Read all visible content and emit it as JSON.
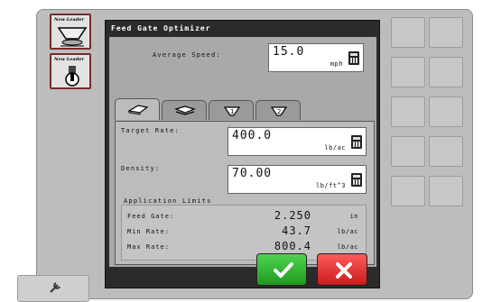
{
  "left_panel": {
    "brand_1": "New Leader",
    "brand_2": "New Leader"
  },
  "dialog": {
    "title": "Feed Gate Optimizer",
    "average_speed": {
      "label": "Average Speed:",
      "value": "15.0",
      "unit": "mph"
    },
    "tabs": [
      {
        "name": "spinner-tab",
        "icon": "spinner-icon"
      },
      {
        "name": "belt-tab",
        "icon": "belt-icon"
      },
      {
        "name": "bin-1-tab",
        "icon": "bin-1-icon"
      },
      {
        "name": "bin-2-tab",
        "icon": "bin-2-icon"
      }
    ],
    "target_rate": {
      "label": "Target Rate:",
      "value": "400.0",
      "unit": "lb/ac"
    },
    "density": {
      "label": "Density:",
      "value": "70.00",
      "unit": "lb/ft^3"
    },
    "limits": {
      "title": "Application Limits",
      "feed_gate": {
        "label": "Feed Gate:",
        "value": "2.250",
        "unit": "in"
      },
      "min_rate": {
        "label": "Min Rate:",
        "value": "43.7",
        "unit": "lb/ac"
      },
      "max_rate": {
        "label": "Max Rate:",
        "value": "800.4",
        "unit": "lb/ac"
      }
    },
    "ok_button": "accept-check-icon",
    "cancel_button": "cancel-x-icon"
  },
  "colors": {
    "ok": "#2fb52f",
    "cancel": "#e03030",
    "dialog_bg": "#2b2b2b",
    "accent_border": "#7a2a2a"
  }
}
